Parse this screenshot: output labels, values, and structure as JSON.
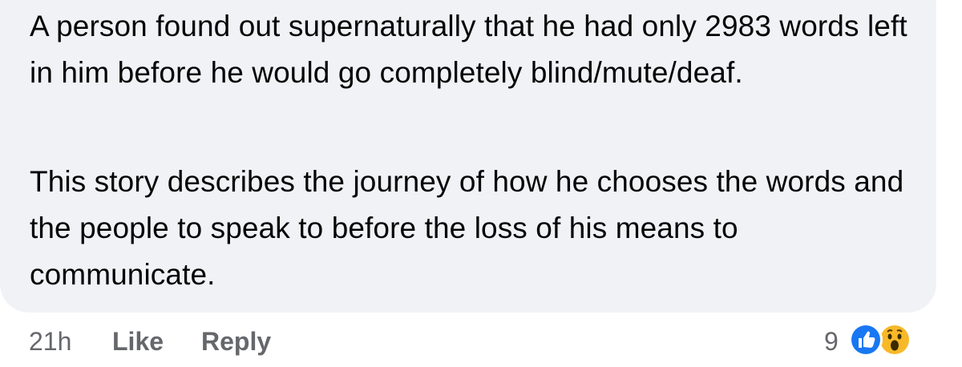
{
  "comment": {
    "paragraphs": [
      "A person found out supernaturally that he had only 2983 words left in him before he would go completely blind/mute/deaf.",
      "This story describes the journey of how he chooses the words and the people to speak to before the loss of his means to communicate."
    ]
  },
  "footer": {
    "timestamp": "21h",
    "like_label": "Like",
    "reply_label": "Reply",
    "reaction_count": "9",
    "reactions": [
      "like-icon",
      "wow-icon"
    ]
  },
  "colors": {
    "bubble_bg": "#f0f2f5",
    "text": "#050505",
    "meta_text": "#65676b",
    "like_blue": "#1877f2",
    "wow_yellow": "#f7b928"
  }
}
